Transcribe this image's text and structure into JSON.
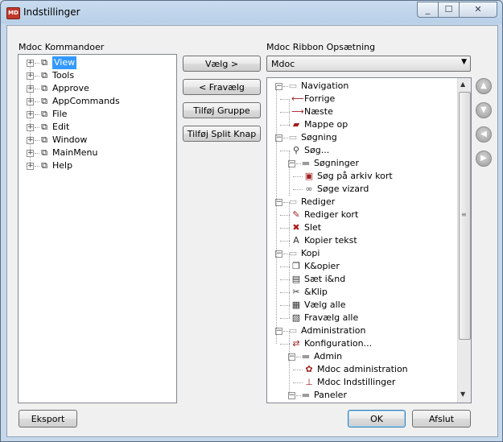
{
  "window": {
    "title": "Indstillinger",
    "app_icon_text": "MD",
    "min": "_",
    "max": "☐",
    "close": "✕"
  },
  "left_panel": {
    "label": "Mdoc Kommandoer",
    "items": [
      "View",
      "Tools",
      "Approve",
      "AppCommands",
      "File",
      "Edit",
      "Window",
      "MainMenu",
      "Help"
    ],
    "selected": "View"
  },
  "buttons": {
    "select": "Vælg >",
    "deselect": "< Fravælg",
    "add_group": "Tilføj Gruppe",
    "add_split": "Tilføj Split Knap",
    "export": "Eksport",
    "ok": "OK",
    "cancel": "Afslut"
  },
  "right_panel": {
    "label": "Mdoc Ribbon Opsætning",
    "combo_value": "Mdoc",
    "tree": [
      {
        "text": "Navigation",
        "icon": "tab-icon"
      },
      {
        "text": "Forrige",
        "icon": "arrow-left-icon"
      },
      {
        "text": "Næste",
        "icon": "arrow-right-icon"
      },
      {
        "text": "Mappe op",
        "icon": "folder-up-icon"
      },
      {
        "text": "Søgning",
        "icon": "tab-icon"
      },
      {
        "text": "Søg...",
        "icon": "search-icon"
      },
      {
        "text": "Søgninger",
        "icon": "split-button-icon"
      },
      {
        "text": "Søg på arkiv kort",
        "icon": "archive-search-icon"
      },
      {
        "text": "Søge vizard",
        "icon": "binoculars-icon"
      },
      {
        "text": "Rediger",
        "icon": "tab-icon"
      },
      {
        "text": "Rediger kort",
        "icon": "edit-card-icon"
      },
      {
        "text": "Slet",
        "icon": "delete-icon"
      },
      {
        "text": "Kopier tekst",
        "icon": "copy-text-icon"
      },
      {
        "text": "Kopi",
        "icon": "tab-icon"
      },
      {
        "text": "K&opier",
        "icon": "copy-icon"
      },
      {
        "text": "Sæt i&nd",
        "icon": "paste-icon"
      },
      {
        "text": "&Klip",
        "icon": "cut-icon"
      },
      {
        "text": "Vælg alle",
        "icon": "select-all-icon"
      },
      {
        "text": "Fravælg alle",
        "icon": "deselect-all-icon"
      },
      {
        "text": "Administration",
        "icon": "tab-icon"
      },
      {
        "text": "Konfiguration...",
        "icon": "config-icon"
      },
      {
        "text": "Admin",
        "icon": "split-button-icon"
      },
      {
        "text": "Mdoc administration",
        "icon": "gear-icon"
      },
      {
        "text": "Mdoc Indstillinger",
        "icon": "settings-sliders-icon"
      },
      {
        "text": "Paneler",
        "icon": "split-button-icon"
      }
    ]
  },
  "side_buttons": [
    "move-up-icon",
    "move-down-icon",
    "move-left-icon",
    "move-right-icon"
  ]
}
